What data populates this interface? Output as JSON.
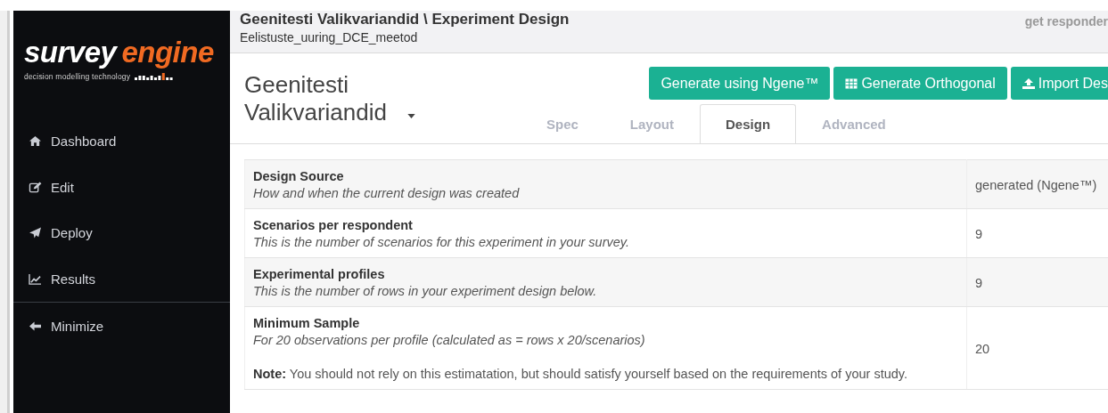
{
  "sidebar": {
    "logo": {
      "first": "survey",
      "second": "engine",
      "tagline": "decision modelling technology"
    },
    "items": [
      {
        "label": "Dashboard"
      },
      {
        "label": "Edit"
      },
      {
        "label": "Deploy"
      },
      {
        "label": "Results"
      }
    ],
    "footer_items": [
      {
        "label": "Minimize"
      }
    ]
  },
  "header": {
    "breadcrumb": "Geenitesti Valikvariandid \\ Experiment Design",
    "subtitle": "Eelistuste_uuring_DCE_meetod",
    "link": "get responder"
  },
  "experiment": {
    "title": "Geenitesti Valikvariandid"
  },
  "buttons": [
    {
      "label": "Generate using Ngene™"
    },
    {
      "label": "Generate Orthogonal"
    },
    {
      "label": "Import Des"
    }
  ],
  "tabs": [
    {
      "label": "Spec",
      "selected": false
    },
    {
      "label": "Layout",
      "selected": false
    },
    {
      "label": "Design",
      "selected": true
    },
    {
      "label": "Advanced",
      "selected": false
    }
  ],
  "table": {
    "rows": [
      {
        "title": "Design Source",
        "description": "How and when the current design was created",
        "value": "generated (Ngene™)"
      },
      {
        "title": "Scenarios per respondent",
        "description": "This is the number of scenarios for this experiment in your survey.",
        "value": "9"
      },
      {
        "title": "Experimental profiles",
        "description": "This is the number of rows in your experiment design below.",
        "value": "9"
      },
      {
        "title": "Minimum Sample",
        "description": "For 20 observations per profile (calculated as = rows x 20/scenarios)",
        "note": "**Note:** You should not rely on this estimatation, but should satisfy yourself based on the requirements of your study.",
        "value": "20"
      }
    ]
  }
}
